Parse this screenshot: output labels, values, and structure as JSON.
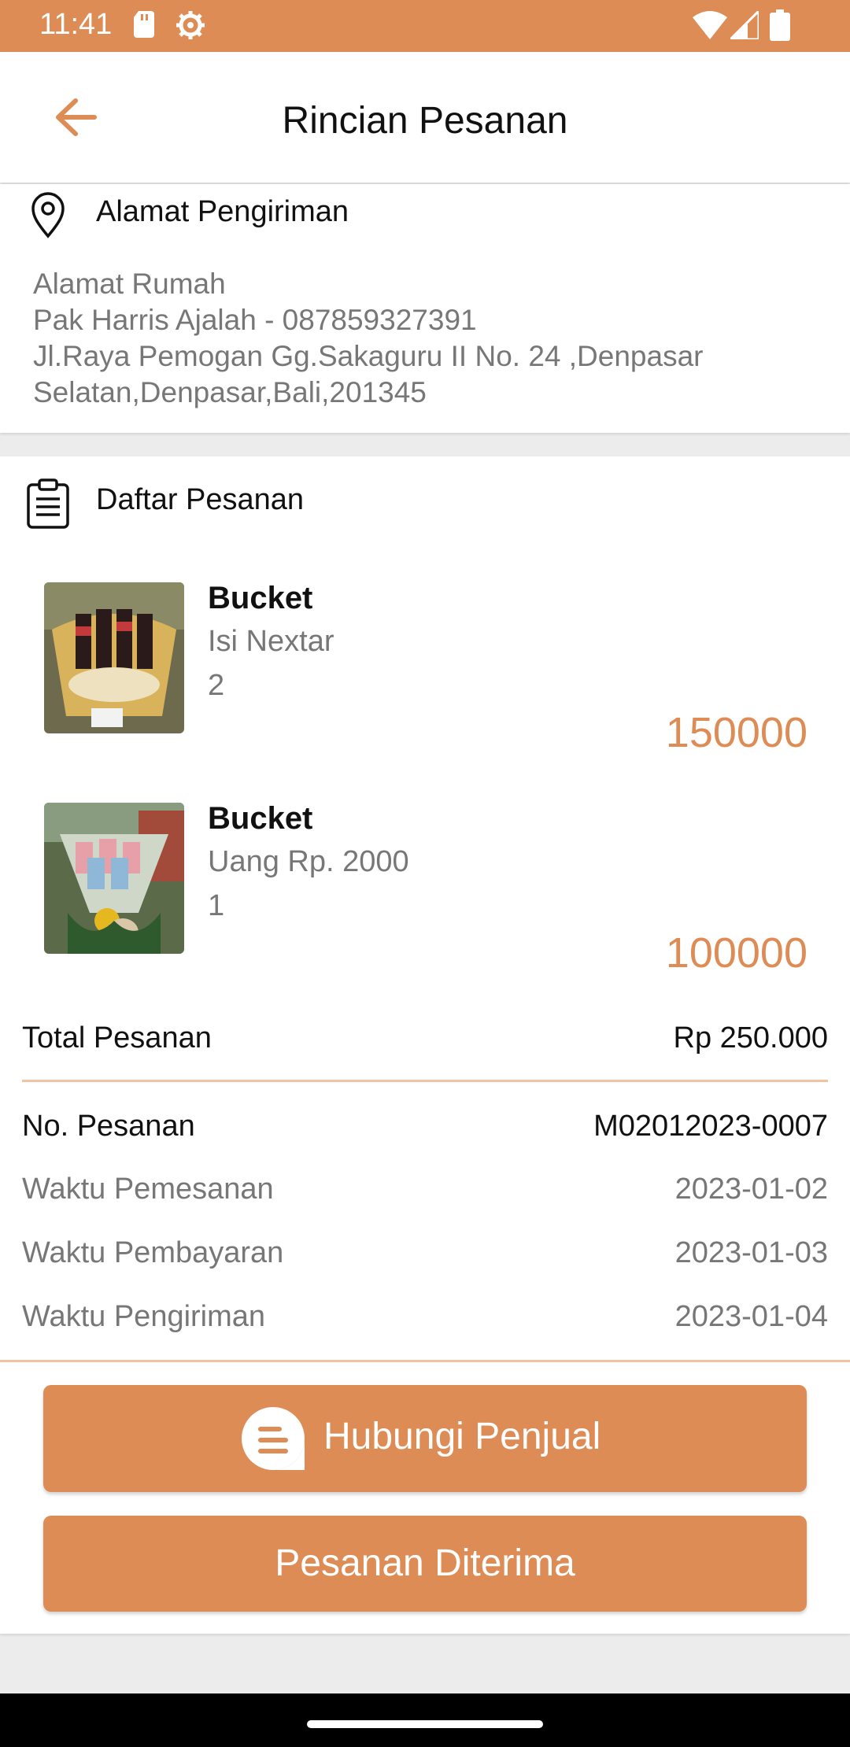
{
  "status_bar": {
    "time": "11:41"
  },
  "header": {
    "title": "Rincian Pesanan"
  },
  "address": {
    "heading": "Alamat Pengiriman",
    "label": "Alamat Rumah",
    "recipient": "Pak Harris Ajalah - 087859327391",
    "street": "Jl.Raya Pemogan Gg.Sakaguru II No. 24 ,Denpasar",
    "region": "Selatan,Denpasar,Bali,201345"
  },
  "orders": {
    "heading": "Daftar Pesanan",
    "items": [
      {
        "name": "Bucket",
        "variant": "Isi Nextar",
        "qty": "2",
        "price": "150000"
      },
      {
        "name": "Bucket",
        "variant": "Uang Rp. 2000",
        "qty": "1",
        "price": "100000"
      }
    ]
  },
  "summary": {
    "total_label": "Total Pesanan",
    "total_value": "Rp 250.000",
    "order_no_label": "No. Pesanan",
    "order_no_value": "M02012023-0007",
    "order_time_label": "Waktu Pemesanan",
    "order_time_value": "2023-01-02",
    "payment_time_label": "Waktu Pembayaran",
    "payment_time_value": "2023-01-03",
    "shipping_time_label": "Waktu Pengiriman",
    "shipping_time_value": "2023-01-04"
  },
  "actions": {
    "contact_label": "Hubungi Penjual",
    "received_label": "Pesanan Diterima"
  },
  "colors": {
    "accent": "#de8c56",
    "divider": "#f1c3a3",
    "muted": "#777777"
  }
}
